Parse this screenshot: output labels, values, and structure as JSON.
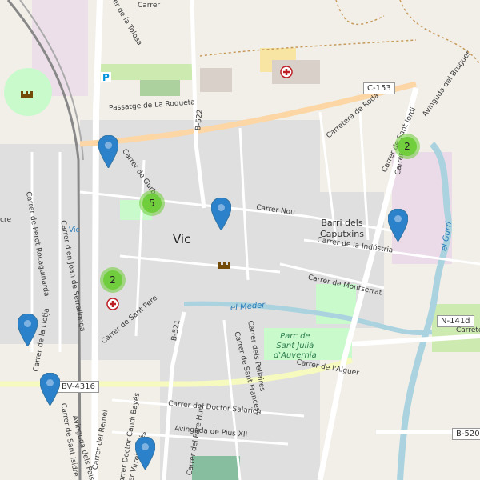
{
  "map": {
    "town": "Vic",
    "town_short": "Vic",
    "districts": {
      "caputxins": "Barri dels\nCaputxins"
    },
    "park": "Parc de\nSant Julià\nd'Auvernia",
    "river_meder": "el Meder",
    "river_gurri": "el Gurri",
    "roads": {
      "c153": "C-153",
      "n141d": "N-141d",
      "bv4316": "BV-4316",
      "b520": "B-520",
      "b522": "B-522",
      "b521": "B-521"
    },
    "streets": {
      "roquetа": "Passatge de La Roqueta",
      "roqueta": "Passatge de La Roqueta",
      "gurb": "Carrer de Gurb",
      "nou": "Carrer Nou",
      "roda": "Carretera de Roda",
      "sant_jordi": "Carrer de Sant Jordi",
      "industria": "Carrer de la Indústria",
      "montserrat": "Carrer de Montserrat",
      "alguer": "Carrer de l'Alguer",
      "pellaires": "Carrer dels Pellaires",
      "sant_francesc": "Carrer de Sant Francesc",
      "sant_pere": "Carrer de Sant Pere",
      "doctor_salarich": "Carrer del Doctor Salarich",
      "pius_xii": "Avinguda de Pius XII",
      "doctor_candi_bayes": "Carrer Doctor Candi Bayés",
      "remei": "Carrer del Remei",
      "sant_isidre": "Carrer de Sant Isidre",
      "avinguda_paisos": "Avinguda dels Països",
      "virrei_aviles": "Carrer Virrei Avilés",
      "pare_huix": "Carrer del Pare Huix",
      "rocaguinarda": "Carrer de Perot Rocaguinarda",
      "joan_serrallonga": "Carrer d'en Joan de Serrallonga",
      "llotja": "Carrer de la Llotja",
      "bruguer": "Avinguda del Bruguer",
      "tolosa": "Carrer de la Tolosa",
      "carretera_e": "Carrete",
      "carretera_w": "cre",
      "gurri_lbl": "el Gurri",
      "carrer_top": "Carrer",
      "carrer_santjordi_lbl": "Carrer"
    },
    "clusters": [
      {
        "count": "2"
      },
      {
        "count": "5"
      },
      {
        "count": "2"
      }
    ],
    "marker_color": "#2b82cb",
    "cluster_color": "#6ecc39",
    "water_color": "#aad3df",
    "park_color": "#c8facc"
  }
}
